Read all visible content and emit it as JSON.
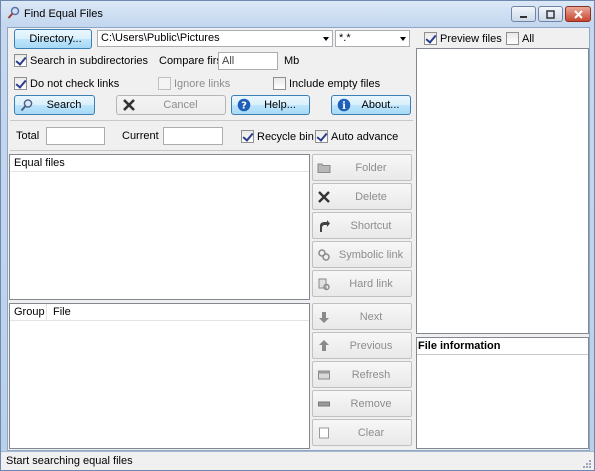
{
  "window": {
    "title": "Find Equal Files"
  },
  "toolbar": {
    "directory_label": "Directory...",
    "path_value": "C:\\Users\\Public\\Pictures",
    "mask_value": "*.*",
    "search_subdirs_label": "Search in subdirectories",
    "search_subdirs_checked": true,
    "compare_first_label": "Compare first",
    "compare_first_value": "All",
    "compare_unit": "Mb",
    "no_links_label": "Do not check links",
    "no_links_checked": true,
    "ignore_links_label": "Ignore links",
    "ignore_links_checked": false,
    "include_empty_label": "Include empty files",
    "include_empty_checked": false,
    "search_label": "Search",
    "cancel_label": "Cancel",
    "help_label": "Help...",
    "about_label": "About..."
  },
  "progress": {
    "total_label": "Total",
    "total_value": "",
    "current_label": "Current",
    "current_value": "",
    "recycle_label": "Recycle bin",
    "recycle_checked": true,
    "auto_advance_label": "Auto advance",
    "auto_advance_checked": true
  },
  "equal_files": {
    "header": "Equal files"
  },
  "group_list": {
    "columns": [
      "Group",
      "File"
    ]
  },
  "actions": {
    "folder": "Folder",
    "delete": "Delete",
    "shortcut": "Shortcut",
    "symbolic_link": "Symbolic link",
    "hard_link": "Hard link",
    "next": "Next",
    "previous": "Previous",
    "refresh": "Refresh",
    "remove": "Remove",
    "clear": "Clear"
  },
  "preview": {
    "preview_label": "Preview files",
    "preview_checked": true,
    "all_label": "All",
    "all_checked": false,
    "file_info_header": "File information"
  },
  "status": {
    "text": "Start searching equal files"
  }
}
